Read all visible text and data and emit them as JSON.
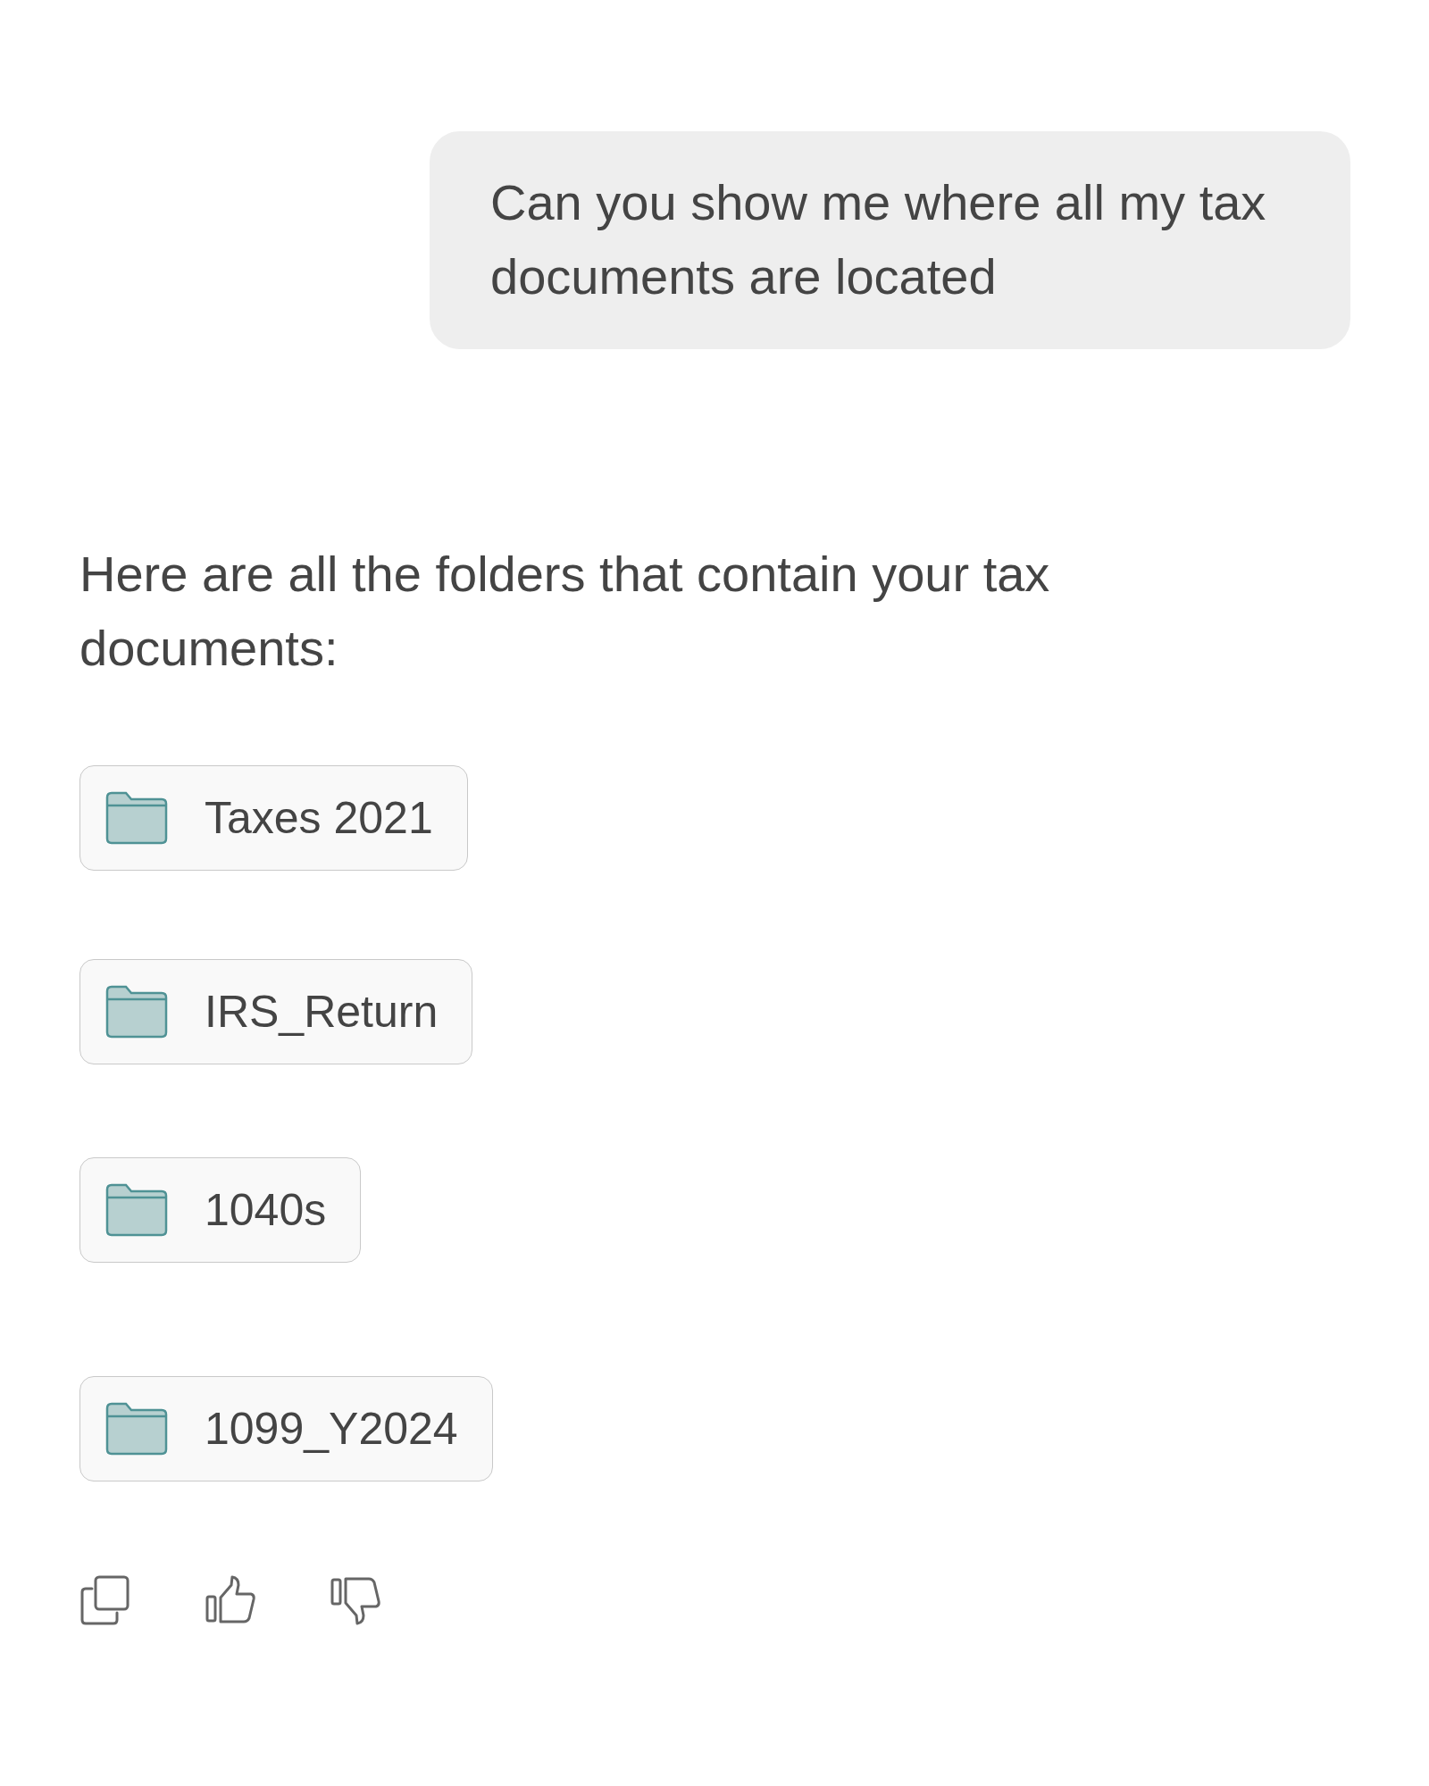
{
  "user_message": {
    "text": "Can you show me where all my tax documents are located"
  },
  "assistant_message": {
    "text": "Here are all the folders that contain your tax documents:",
    "folders": [
      {
        "name": "Taxes 2021"
      },
      {
        "name": "IRS_Return"
      },
      {
        "name": "1040s"
      },
      {
        "name": "1099_Y2024"
      }
    ]
  }
}
